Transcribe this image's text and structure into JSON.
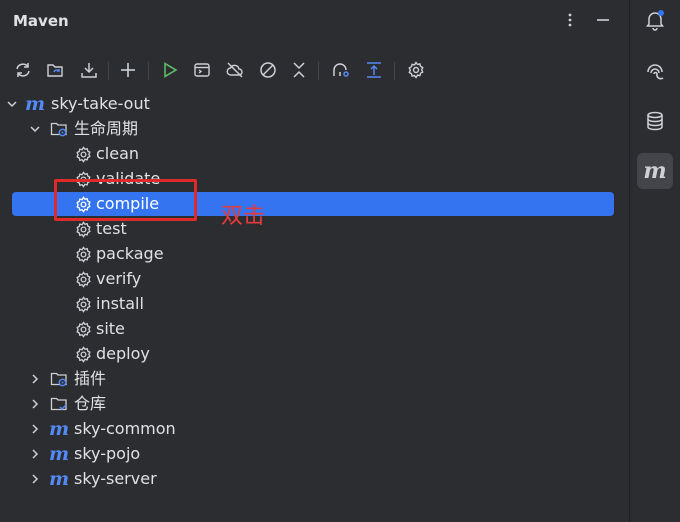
{
  "panel": {
    "title": "Maven"
  },
  "toolbar": {
    "icons": [
      "reload-all-icon",
      "reimport-icon",
      "download-icon",
      "add-icon",
      "run-icon",
      "execute-goal-icon",
      "offline-icon",
      "skip-tests-icon",
      "collapse-icon",
      "show-dependencies-icon",
      "expand-all-icon",
      "settings-icon"
    ]
  },
  "tree": {
    "root": {
      "label": "sky-take-out",
      "icon": "m"
    },
    "lifecycle": {
      "label": "生命周期"
    },
    "goals": [
      "clean",
      "validate",
      "compile",
      "test",
      "package",
      "verify",
      "install",
      "site",
      "deploy"
    ],
    "plugins": {
      "label": "插件"
    },
    "repos": {
      "label": "仓库"
    },
    "modules": [
      "sky-common",
      "sky-pojo",
      "sky-server"
    ]
  },
  "selected_goal": "compile",
  "annotation": {
    "text": "双击",
    "color": "#e02a2a"
  },
  "sidebar": {
    "icons": [
      "notifications-icon",
      "ai-assistant-icon",
      "database-icon",
      "maven-icon"
    ],
    "maven_glyph": "m"
  },
  "colors": {
    "accent": "#3574f0",
    "maven_m": "#548af7",
    "background": "#2b2d30"
  }
}
